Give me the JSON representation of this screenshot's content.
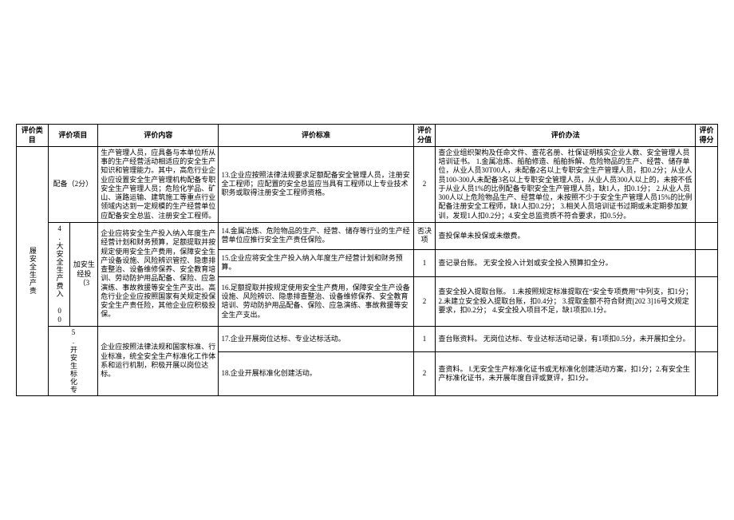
{
  "header": {
    "col_category": "评价类目",
    "col_project": "评价项目",
    "col_content": "评价内容",
    "col_standard": "评价标准",
    "col_points": "评价分值",
    "col_method": "评价办法",
    "col_score": "评价得分"
  },
  "rows": [
    {
      "category": "",
      "sub1": "",
      "config": "配备（2分）",
      "content": "生产管理人员，应具备与本单位所从事的生产经营活动相适应的安全生产知识和管理能力。其中，高危行业企业应设置安全生产管理机构配备专职安全生产管理人员；危险化学品、矿山、道路运输、建筑施工等重点行业领域内达到一定规模的生产经营单位应配备安全总监、注册安全工程师。",
      "standard": "13.企业应按照法律法规要求足额配备安全管理人员，注册安全工程师；应配置的安全总监应当具有工程师以上专业技术职务或取得注册安全工程师资格。",
      "points": "2",
      "method": "查企业组织架构及任命文件、查花名册、社保证明核实企业人数、安全管理人员培训证书。\n1.金属冶炼、船舶修造、船舶拆解、危险物品的生产、经营、储存单位，从业人员30T00人，未配备2名以上专职安全生产管理人员，扣0.2分；从业人员100-300人未配备3名以上专职安全管理人员，从业人员300人以上的，未按不低于从业人员1%的比例配备专职安全生产管理人员，缺1人，扣0.1分；\n2.从业人员300人以上危险物品生产、经营单位，未按照不少于安全生产管理人员15%的比例配备注册安全工程师，缺1人扣0.2分；\n3.相关人员培训证书过期或未定期参加复训，发现1人扣0.2分；4.安全总监资质不符合要求，扣0.5分。",
      "score": ""
    },
    {
      "category_v": "履安全生产责",
      "sub1_v": "4.大安全生产费入 00",
      "config": "加安生经投（3",
      "content": "企业应将安全生产投入纳入年度生产经营计划和财务预算，足额提取并按规定使用安全生产费用，保障安全生产设备设施、风险辨识管控、隐患排查整治、设备维修保养、安全教育培训、劳动防护用品配备、保险、应急演练、事故救援等安全生产支出。高危行业企业应按照国家有关规定投保安全生产责任险，其他企业应积极投保。",
      "standard_a": "14.金属冶炼、危险物品的生产、经营、储存等行业的生产经营单位应推行安全生产责任保险。",
      "points_a": "否决项",
      "method_a": "查投保单未投保或未缴费。",
      "standard_b": "15.企业应将安全生产投入纳入年度生产经营计划和财务预算。",
      "points_b": "1",
      "method_b": "查记录台账。\n无安全投入计划或安全投入预算扣全分。",
      "standard_c": "16.足额提取并按规定使用安全生产费用，保障安全生产设备设施、风险辨识、隐患排查整治、设备维修保养、安全教育培训、劳动防护用品配备、保险、应急演练、事故救援等安全生产支出。",
      "points_c": "2",
      "method_c": "查安全投入提取台账。\n1.未按照规定标准提取在“安全专项费用”中列支，扣1分；\n2.未建立安全投入提取台账，扣0.4分；\n3.提取金额不符合财资[202 3]16号文规定要求，扣0.2分；\n4.安全投入项目不足，缺1项扣0.1分。"
    },
    {
      "sub1_v": "5.开安生标化专",
      "content": "企业应按照法律法规和国家标准、行业标准，统全安全生产标准化工作体系和运行机制，积极开展以岗位达标。",
      "standard_a": "17.企业开展岗位达标、专业达标活动。",
      "points_a": "1",
      "method_a": "查台账资料。\n无岗位达标、专业达标活动记录，有1项扣0.5分，未开展扣全分。",
      "standard_b": "18.企业开展标准化创建活动。",
      "points_b": "2",
      "method_b": "查资料。\nⅠ.无安全生产标准化证书或无标准化创建活动方案，扣1分；2.有安全生产标准化证书，未开展年度自评或复评，扣1分。"
    }
  ]
}
